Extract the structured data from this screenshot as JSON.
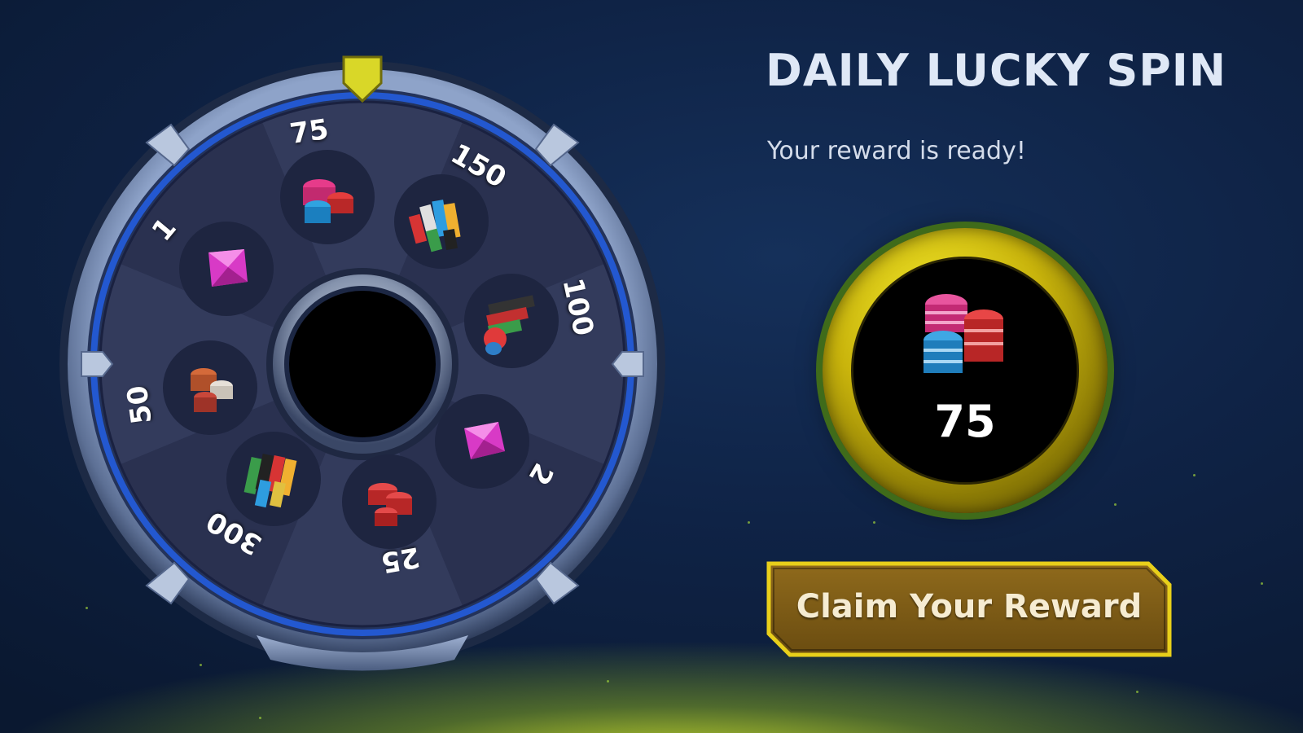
{
  "title": "DAILY LUCKY SPIN",
  "subtitle": "Your reward is ready!",
  "reward": {
    "amount": "75",
    "icon": "chips-stack-icon"
  },
  "claim_button": {
    "label": "Claim Your Reward"
  },
  "wheel": {
    "segments": [
      {
        "label": "75",
        "prize": "chips-small-stack-icon"
      },
      {
        "label": "150",
        "prize": "chips-medium-stack-icon"
      },
      {
        "label": "100",
        "prize": "chips-stack-icon"
      },
      {
        "label": "2",
        "prize": "gem-icon"
      },
      {
        "label": "25",
        "prize": "chips-red-stack-icon"
      },
      {
        "label": "300",
        "prize": "chips-large-stack-icon"
      },
      {
        "label": "50",
        "prize": "chips-stack-icon"
      },
      {
        "label": "1",
        "prize": "gem-icon"
      }
    ]
  },
  "colors": {
    "accent_gold": "#c9b40c",
    "gem_pink": "#e23cd0",
    "wheel_blue": "#1f4fb5"
  }
}
